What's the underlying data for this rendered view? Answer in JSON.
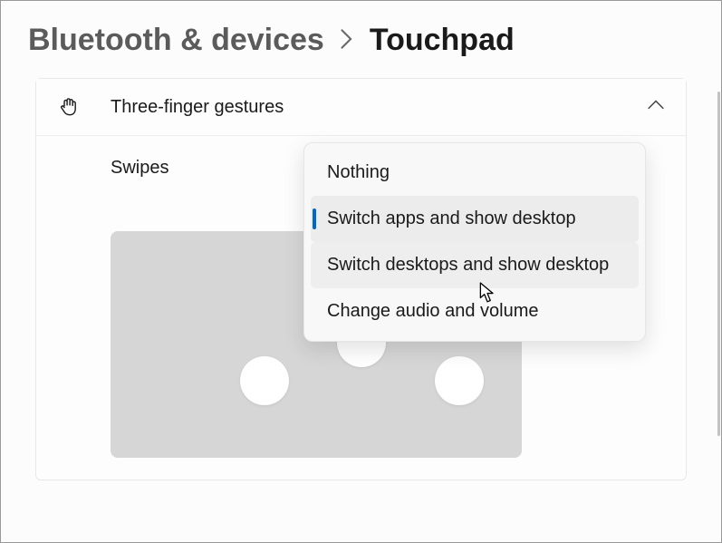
{
  "breadcrumb": {
    "parent": "Bluetooth & devices",
    "current": "Touchpad"
  },
  "panel": {
    "title": "Three-finger gestures",
    "swipes_label": "Swipes"
  },
  "dropdown": {
    "items": [
      {
        "label": "Nothing"
      },
      {
        "label": "Switch apps and show desktop"
      },
      {
        "label": "Switch desktops and show desktop"
      },
      {
        "label": "Change audio and volume"
      }
    ]
  }
}
